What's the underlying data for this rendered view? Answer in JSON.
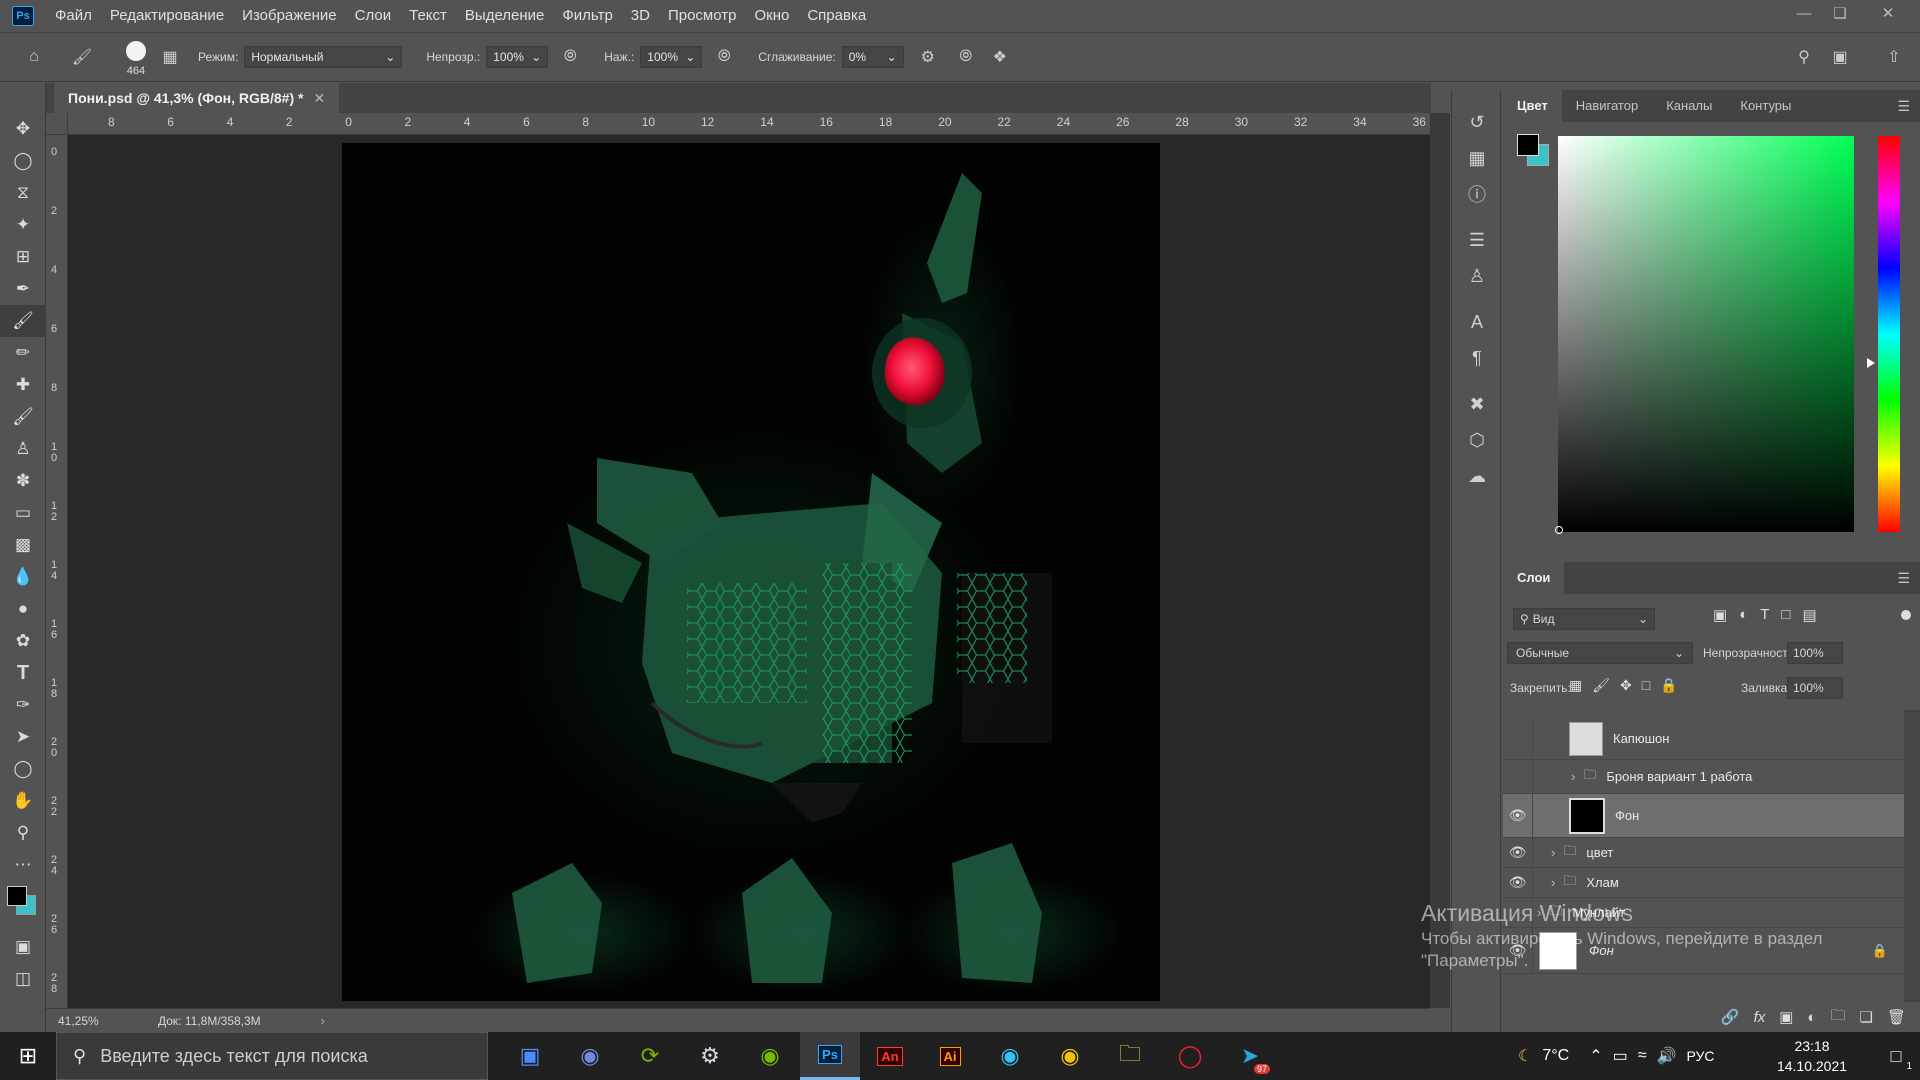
{
  "app": {
    "logo": "Ps",
    "menu": [
      "Файл",
      "Редактирование",
      "Изображение",
      "Слои",
      "Текст",
      "Выделение",
      "Фильтр",
      "3D",
      "Просмотр",
      "Окно",
      "Справка"
    ]
  },
  "options": {
    "brush_size": "464",
    "mode_label": "Режим:",
    "mode_value": "Нормальный",
    "opacity_label": "Непрозр.:",
    "opacity_value": "100%",
    "flow_label": "Наж.:",
    "flow_value": "100%",
    "smoothing_label": "Сглаживание:",
    "smoothing_value": "0%"
  },
  "document": {
    "tab_title": "Пони.psd @ 41,3% (Фон, RGB/8#) *",
    "zoom": "41,25%",
    "doc_size": "Док: 11,8M/358,3M"
  },
  "ruler_h": [
    "8",
    "6",
    "4",
    "2",
    "0",
    "2",
    "4",
    "6",
    "8",
    "10",
    "12",
    "14",
    "16",
    "18",
    "20",
    "22",
    "24",
    "26",
    "28",
    "30",
    "32",
    "34",
    "36"
  ],
  "ruler_v": [
    "0",
    "2",
    "4",
    "6",
    "8",
    "1 0",
    "1 2",
    "1 4",
    "1 6",
    "1 8",
    "2 0",
    "2 2",
    "2 4",
    "2 6",
    "2 8"
  ],
  "color_panel": {
    "tabs": [
      "Цвет",
      "Навигатор",
      "Каналы",
      "Контуры"
    ],
    "hue_color": "#00ff55"
  },
  "layers_panel": {
    "title": "Слои",
    "filter": "Вид",
    "blend_mode": "Обычные",
    "opacity_label": "Непрозрачность:",
    "opacity_value": "100%",
    "lock_label": "Закрепить:",
    "fill_label": "Заливка:",
    "fill_value": "100%",
    "layers": [
      {
        "name": "Капюшон",
        "visible": false
      },
      {
        "name": "Броня вариант 1 работа",
        "visible": false
      },
      {
        "name": "Фон",
        "visible": true
      },
      {
        "name": "цвет",
        "visible": true
      },
      {
        "name": "Хлам",
        "visible": true
      },
      {
        "name": "Мунлайт",
        "visible": false
      },
      {
        "name": "Фон",
        "visible": true
      }
    ]
  },
  "watermark": {
    "title": "Активация Windows",
    "subtitle_1": "Чтобы активировать Windows, перейдите в раздел",
    "subtitle_2": "\"Параметры\"."
  },
  "taskbar": {
    "search_placeholder": "Введите здесь текст для поиска",
    "weather": "7°C",
    "language": "РУС",
    "time": "23:18",
    "date": "14.10.2021",
    "notification_count": "1",
    "telegram_badge": "97"
  }
}
